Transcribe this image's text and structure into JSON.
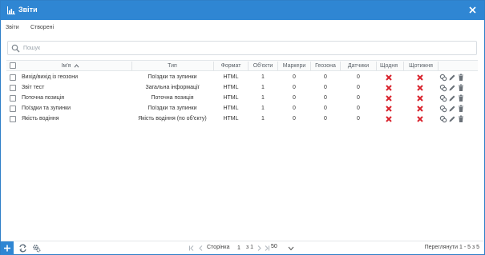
{
  "window": {
    "title": "Звіти",
    "accent_color": "#2f86d3"
  },
  "tabs": [
    {
      "label": "Звіти"
    },
    {
      "label": "Створені"
    }
  ],
  "search": {
    "placeholder": "Пошук",
    "value": ""
  },
  "table": {
    "columns": [
      {
        "label": "Ім'я",
        "sort": "ascending"
      },
      {
        "label": "Тип"
      },
      {
        "label": "Формат"
      },
      {
        "label": "Об'єкти"
      },
      {
        "label": "Маркери"
      },
      {
        "label": "Геозона"
      },
      {
        "label": "Датчики"
      },
      {
        "label": "Щодня"
      },
      {
        "label": "Щотижня"
      }
    ],
    "rows": [
      {
        "name": "Вихід/вихід із геозони",
        "type": "Поїздки та зупинки",
        "format": "HTML",
        "objects": "1",
        "markers": "0",
        "geozone": "0",
        "sensors": "0",
        "daily": false,
        "weekly": false
      },
      {
        "name": "Звіт тест",
        "type": "Загальна інформації",
        "format": "HTML",
        "objects": "1",
        "markers": "0",
        "geozone": "0",
        "sensors": "0",
        "daily": false,
        "weekly": false
      },
      {
        "name": "Поточна позиція",
        "type": "Поточна позиція",
        "format": "HTML",
        "objects": "1",
        "markers": "0",
        "geozone": "0",
        "sensors": "0",
        "daily": false,
        "weekly": false
      },
      {
        "name": "Поїздки та зупинки",
        "type": "Поїздки та зупинки",
        "format": "HTML",
        "objects": "1",
        "markers": "0",
        "geozone": "0",
        "sensors": "0",
        "daily": false,
        "weekly": false
      },
      {
        "name": "Якість водіння",
        "type": "Якість водіння (по об'єкту)",
        "format": "HTML",
        "objects": "1",
        "markers": "0",
        "geozone": "0",
        "sensors": "0",
        "daily": false,
        "weekly": false
      }
    ],
    "row_actions": [
      "duplicate-icon",
      "edit-icon",
      "delete-icon"
    ],
    "disabled_mark_color": "#d9232d"
  },
  "footer": {
    "page_label": "Сторінка",
    "page_value": "1",
    "of_label": "з 1",
    "page_size": "50",
    "summary": "Переглянути 1 - 5 з 5"
  }
}
